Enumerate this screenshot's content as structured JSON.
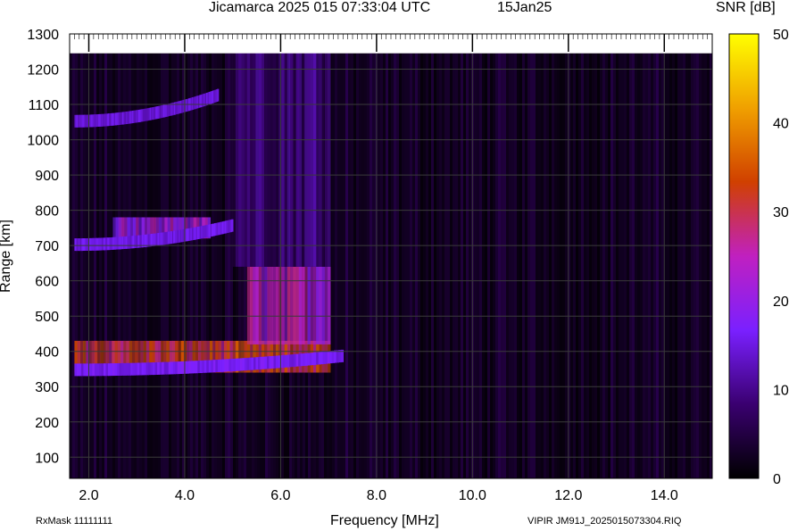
{
  "header": {
    "title": "Jicamarca 2025 015 07:33:04 UTC",
    "date": "15Jan25",
    "colorbar_label": "SNR [dB]"
  },
  "footer": {
    "rxmask": "RxMask 11111111",
    "file": "VIPIR  JM91J_2025015073304.RIQ"
  },
  "chart_data": {
    "type": "heatmap",
    "title": "Jicamarca 2025 015 07:33:04 UTC",
    "xlabel": "Frequency [MHz]",
    "ylabel": "Range [km]",
    "xlim": [
      1.6,
      15.0
    ],
    "ylim": [
      40,
      1300
    ],
    "x_ticks": [
      "2.0",
      "4.0",
      "6.0",
      "8.0",
      "10.0",
      "12.0",
      "14.0"
    ],
    "x_tick_values": [
      2,
      4,
      6,
      8,
      10,
      12,
      14
    ],
    "y_ticks": [
      "100",
      "200",
      "300",
      "400",
      "500",
      "600",
      "700",
      "800",
      "900",
      "1000",
      "1100",
      "1200",
      "1300"
    ],
    "y_tick_values": [
      100,
      200,
      300,
      400,
      500,
      600,
      700,
      800,
      900,
      1000,
      1100,
      1200,
      1300
    ],
    "colorbar": {
      "label": "SNR [dB]",
      "range": [
        0,
        50
      ],
      "ticks": [
        "0",
        "10",
        "20",
        "30",
        "40",
        "50"
      ],
      "tick_values": [
        0,
        10,
        20,
        30,
        40,
        50
      ],
      "colors": [
        "#000000",
        "#3a0070",
        "#7a20ff",
        "#c020c0",
        "#d04000",
        "#f0a000",
        "#ffff00"
      ]
    },
    "grid": true,
    "traces": [
      {
        "kind": "trace",
        "f_start": 1.7,
        "f_end": 7.3,
        "h_start": 335,
        "h_end": 375,
        "snr": 14
      },
      {
        "kind": "trace",
        "f_start": 1.7,
        "f_end": 5.0,
        "h_start": 690,
        "h_end": 745,
        "snr": 13
      },
      {
        "kind": "trace",
        "f_start": 1.7,
        "f_end": 4.7,
        "h_start": 1040,
        "h_end": 1115,
        "snr": 12
      }
    ],
    "regions": [
      {
        "f1": 1.7,
        "f2": 7.0,
        "h_low": 340,
        "h_high": 430,
        "snr": 32
      },
      {
        "f1": 5.3,
        "f2": 7.0,
        "h_low": 420,
        "h_high": 640,
        "snr": 24
      },
      {
        "f1": 5.0,
        "f2": 7.0,
        "h_low": 640,
        "h_high": 1250,
        "snr": 11
      },
      {
        "f1": 2.5,
        "f2": 4.5,
        "h_low": 720,
        "h_high": 780,
        "snr": 22
      }
    ]
  }
}
